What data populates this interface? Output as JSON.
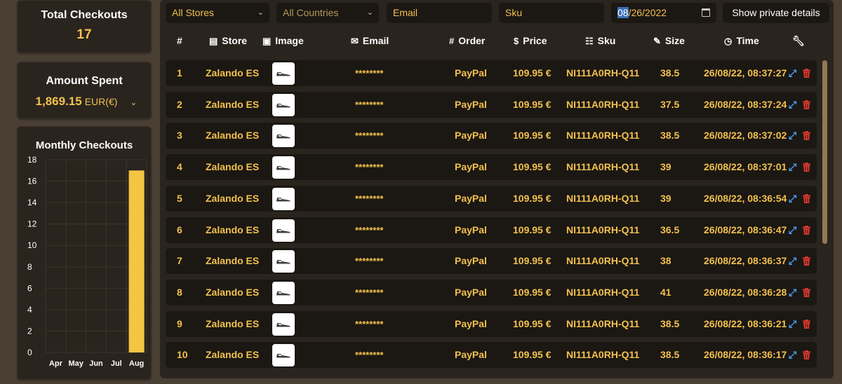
{
  "summary": {
    "total_checkouts_label": "Total Checkouts",
    "total_checkouts_value": "17",
    "amount_spent_label": "Amount Spent",
    "amount_spent_value": "1,869.15",
    "amount_spent_currency": "EUR(€)",
    "monthly_label": "Monthly Checkouts"
  },
  "chart_data": {
    "type": "bar",
    "title": "Monthly Checkouts",
    "categories": [
      "Apr",
      "May",
      "Jun",
      "Jul",
      "Aug"
    ],
    "values": [
      0,
      0,
      0,
      0,
      17
    ],
    "ylim": [
      0,
      18
    ],
    "yticks": [
      "0",
      "2",
      "4",
      "6",
      "8",
      "10",
      "12",
      "14",
      "16",
      "18"
    ],
    "grid": true,
    "bar_color": "#f4c542"
  },
  "filters": {
    "stores": "All Stores",
    "countries": "All Countries",
    "email_placeholder": "Email",
    "sku_placeholder": "Sku",
    "date_month": "08",
    "date_rest": "/26/2022",
    "private_button": "Show private details"
  },
  "columns": {
    "num": "#",
    "store": "Store",
    "image": "Image",
    "email": "Email",
    "order": "Order",
    "price": "Price",
    "sku": "Sku",
    "size": "Size",
    "time": "Time"
  },
  "rows": [
    {
      "num": "1",
      "store": "Zalando ES",
      "email": "********",
      "order": "PayPal",
      "price": "109.95 €",
      "sku": "NI111A0RH-Q11",
      "size": "38.5",
      "time": "26/08/22, 08:37:27"
    },
    {
      "num": "2",
      "store": "Zalando ES",
      "email": "********",
      "order": "PayPal",
      "price": "109.95 €",
      "sku": "NI111A0RH-Q11",
      "size": "37.5",
      "time": "26/08/22, 08:37:24"
    },
    {
      "num": "3",
      "store": "Zalando ES",
      "email": "********",
      "order": "PayPal",
      "price": "109.95 €",
      "sku": "NI111A0RH-Q11",
      "size": "38.5",
      "time": "26/08/22, 08:37:02"
    },
    {
      "num": "4",
      "store": "Zalando ES",
      "email": "********",
      "order": "PayPal",
      "price": "109.95 €",
      "sku": "NI111A0RH-Q11",
      "size": "39",
      "time": "26/08/22, 08:37:01"
    },
    {
      "num": "5",
      "store": "Zalando ES",
      "email": "********",
      "order": "PayPal",
      "price": "109.95 €",
      "sku": "NI111A0RH-Q11",
      "size": "39",
      "time": "26/08/22, 08:36:54"
    },
    {
      "num": "6",
      "store": "Zalando ES",
      "email": "********",
      "order": "PayPal",
      "price": "109.95 €",
      "sku": "NI111A0RH-Q11",
      "size": "36.5",
      "time": "26/08/22, 08:36:47"
    },
    {
      "num": "7",
      "store": "Zalando ES",
      "email": "********",
      "order": "PayPal",
      "price": "109.95 €",
      "sku": "NI111A0RH-Q11",
      "size": "38",
      "time": "26/08/22, 08:36:37"
    },
    {
      "num": "8",
      "store": "Zalando ES",
      "email": "********",
      "order": "PayPal",
      "price": "109.95 €",
      "sku": "NI111A0RH-Q11",
      "size": "41",
      "time": "26/08/22, 08:36:28"
    },
    {
      "num": "9",
      "store": "Zalando ES",
      "email": "********",
      "order": "PayPal",
      "price": "109.95 €",
      "sku": "NI111A0RH-Q11",
      "size": "38.5",
      "time": "26/08/22, 08:36:21"
    },
    {
      "num": "10",
      "store": "Zalando ES",
      "email": "********",
      "order": "PayPal",
      "price": "109.95 €",
      "sku": "NI111A0RH-Q11",
      "size": "38.5",
      "time": "26/08/22, 08:36:17"
    }
  ],
  "icons": {
    "store": "store-icon",
    "image": "image-icon",
    "email": "envelope-icon",
    "order": "hash-icon",
    "price": "dollar-icon",
    "sku": "clipboard-icon",
    "size": "ruler-icon",
    "time": "clock-icon",
    "actions": "wrench-icon",
    "expand": "expand-icon",
    "delete": "trash-icon"
  }
}
